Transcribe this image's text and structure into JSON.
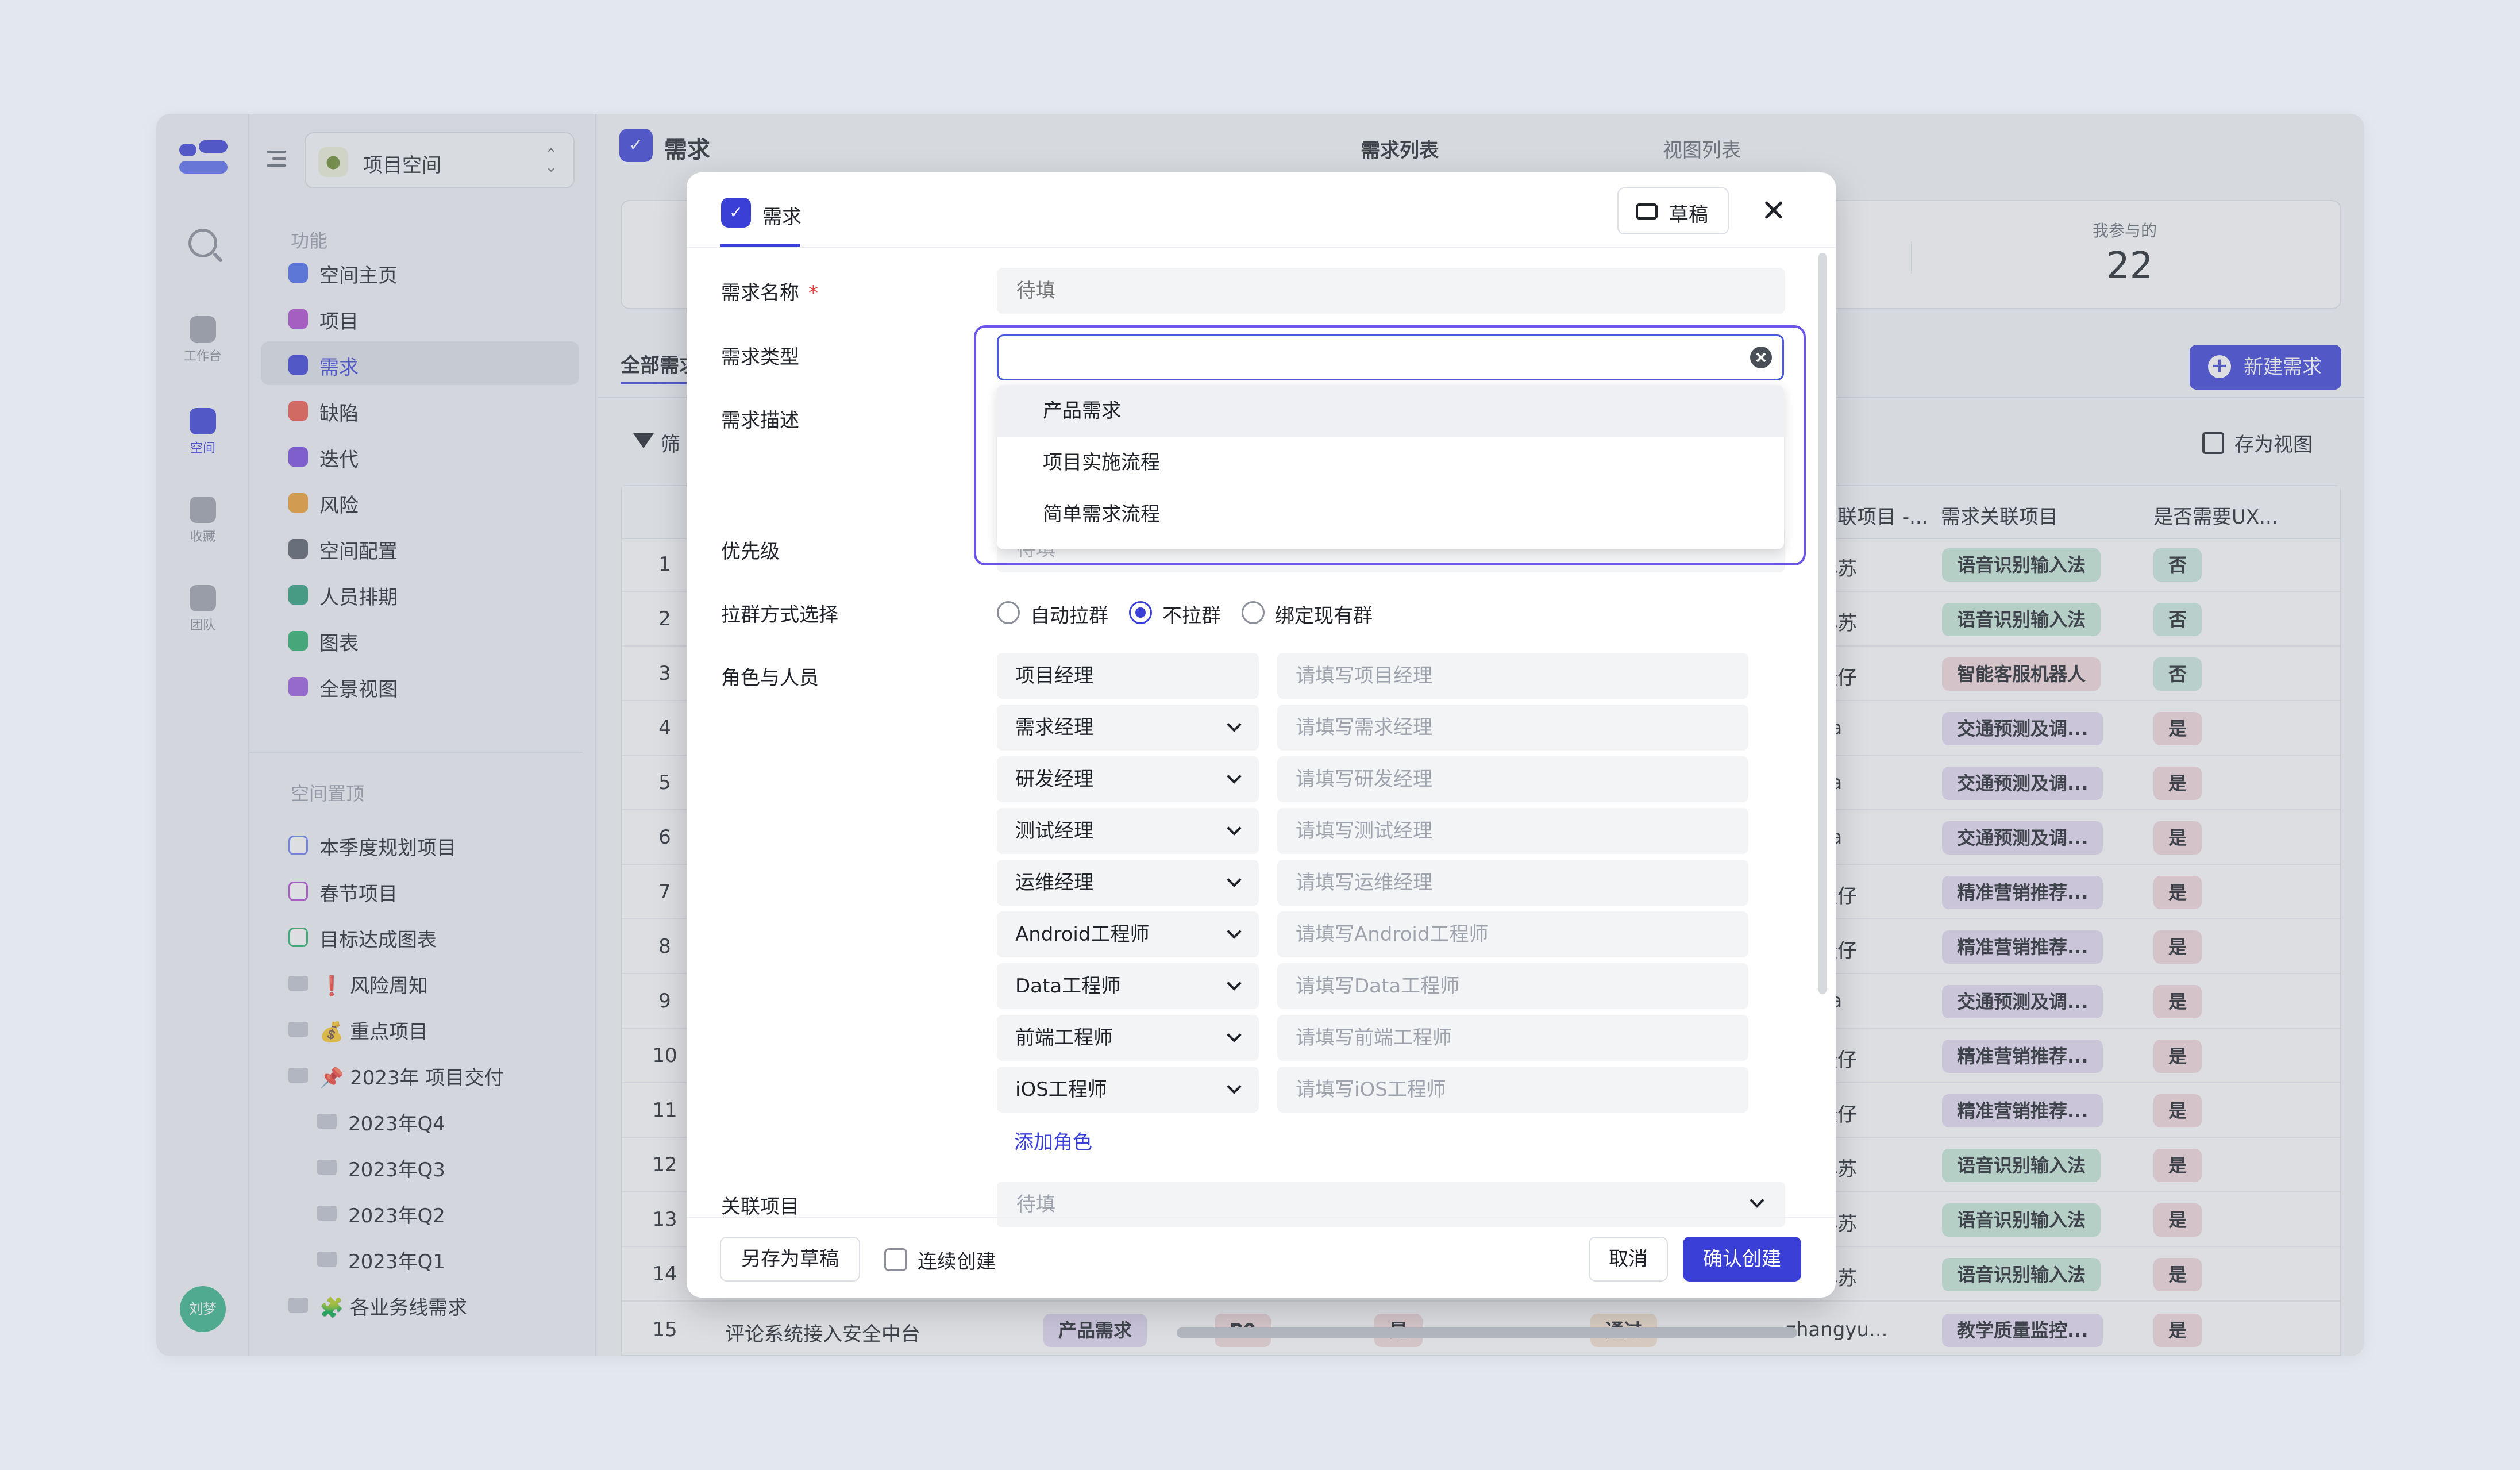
{
  "rail": {
    "items": [
      {
        "label": "工作台"
      },
      {
        "label": "空间"
      },
      {
        "label": "收藏"
      },
      {
        "label": "团队"
      }
    ],
    "avatar": "刘梦"
  },
  "sidebar": {
    "space": "项目空间",
    "section_functions": "功能",
    "functions": [
      {
        "label": "空间主页",
        "color": "#4a6cf0"
      },
      {
        "label": "项目",
        "color": "#b04ad0"
      },
      {
        "label": "需求",
        "color": "#3a3fd6"
      },
      {
        "label": "缺陷",
        "color": "#f05a4a"
      },
      {
        "label": "迭代",
        "color": "#7a4ae0"
      },
      {
        "label": "风险",
        "color": "#f0a030"
      },
      {
        "label": "空间配置",
        "color": "#5a5f6a"
      },
      {
        "label": "人员排期",
        "color": "#2aa07a"
      },
      {
        "label": "图表",
        "color": "#2ab06a"
      },
      {
        "label": "全景视图",
        "color": "#9a5ae0"
      }
    ],
    "section_pinned": "空间置顶",
    "pinned": [
      {
        "label": "本季度规划项目",
        "color": "#6a7ef0"
      },
      {
        "label": "春节项目",
        "color": "#b04ad0"
      },
      {
        "label": "目标达成图表",
        "color": "#2ab06a"
      },
      {
        "label": "❗ 风险周知"
      },
      {
        "label": "💰 重点项目"
      },
      {
        "label": "📌 2023年 项目交付"
      },
      {
        "label": "2023年Q4"
      },
      {
        "label": "2023年Q3"
      },
      {
        "label": "2023年Q2"
      },
      {
        "label": "2023年Q1"
      },
      {
        "label": "🧩 各业务线需求"
      }
    ]
  },
  "main": {
    "title": "需求",
    "tabs": [
      "需求列表",
      "视图列表"
    ],
    "stat_label": "我参与的",
    "stat_value": "22",
    "all_tab": "全部需求",
    "new_button": "新建需求",
    "filter": "筛",
    "save_view": "存为视图",
    "columns": {
      "c1": "关联项目 -...",
      "c2": "需求关联项目",
      "c3": "是否需要UX..."
    },
    "rows": [
      {
        "num": "1",
        "user": "小苏",
        "project": "语音识别输入法",
        "ux": "否"
      },
      {
        "num": "2",
        "user": "小苏",
        "project": "语音识别输入法",
        "ux": "否"
      },
      {
        "num": "3",
        "user": "隆仔",
        "project": "智能客服机器人",
        "ux": "否"
      },
      {
        "num": "4",
        "user": "ha",
        "project": "交通预测及调...",
        "ux": "是"
      },
      {
        "num": "5",
        "user": "ha",
        "project": "交通预测及调...",
        "ux": "是"
      },
      {
        "num": "6",
        "user": "ha",
        "project": "交通预测及调...",
        "ux": "是"
      },
      {
        "num": "7",
        "user": "隆仔",
        "project": "精准营销推荐...",
        "ux": "是"
      },
      {
        "num": "8",
        "user": "隆仔",
        "project": "精准营销推荐...",
        "ux": "是"
      },
      {
        "num": "9",
        "user": "ha",
        "project": "交通预测及调...",
        "ux": "是"
      },
      {
        "num": "10",
        "user": "隆仔",
        "project": "精准营销推荐...",
        "ux": "是"
      },
      {
        "num": "11",
        "user": "隆仔",
        "project": "精准营销推荐...",
        "ux": "是"
      },
      {
        "num": "12",
        "user": "小苏",
        "project": "语音识别输入法",
        "ux": "是"
      },
      {
        "num": "13",
        "user": "小苏",
        "project": "语音识别输入法",
        "ux": "是"
      },
      {
        "num": "14",
        "user": "小苏",
        "project": "语音识别输入法",
        "ux": "是"
      }
    ],
    "last_row": {
      "num": "15",
      "title": "评论系统接入安全中台",
      "type": "产品需求",
      "priority": "P0",
      "flag": "是",
      "status": "通过",
      "user": "zhangyu...",
      "project": "教学质量监控...",
      "ux": "是"
    }
  },
  "modal": {
    "tab": "需求",
    "draft_button": "草稿",
    "fields": {
      "name_label": "需求名称",
      "name_placeholder": "待填",
      "type_label": "需求类型",
      "desc_label": "需求描述",
      "priority_label": "优先级",
      "priority_placeholder": "待填",
      "group_label": "拉群方式选择",
      "roles_label": "角色与人员",
      "related_label": "关联项目",
      "related_placeholder": "待填"
    },
    "type_options": [
      "产品需求",
      "项目实施流程",
      "简单需求流程"
    ],
    "group_options": [
      {
        "label": "自动拉群",
        "checked": false
      },
      {
        "label": "不拉群",
        "checked": true
      },
      {
        "label": "绑定现有群",
        "checked": false
      }
    ],
    "roles": [
      {
        "role": "项目经理",
        "placeholder": "请填写项目经理"
      },
      {
        "role": "需求经理",
        "placeholder": "请填写需求经理"
      },
      {
        "role": "研发经理",
        "placeholder": "请填写研发经理"
      },
      {
        "role": "测试经理",
        "placeholder": "请填写测试经理"
      },
      {
        "role": "运维经理",
        "placeholder": "请填写运维经理"
      },
      {
        "role": "Android工程师",
        "placeholder": "请填写Android工程师"
      },
      {
        "role": "Data工程师",
        "placeholder": "请填写Data工程师"
      },
      {
        "role": "前端工程师",
        "placeholder": "请填写前端工程师"
      },
      {
        "role": "iOS工程师",
        "placeholder": "请填写iOS工程师"
      }
    ],
    "add_role": "添加角色",
    "footer": {
      "save_draft": "另存为草稿",
      "continuous": "连续创建",
      "cancel": "取消",
      "confirm": "确认创建"
    }
  }
}
